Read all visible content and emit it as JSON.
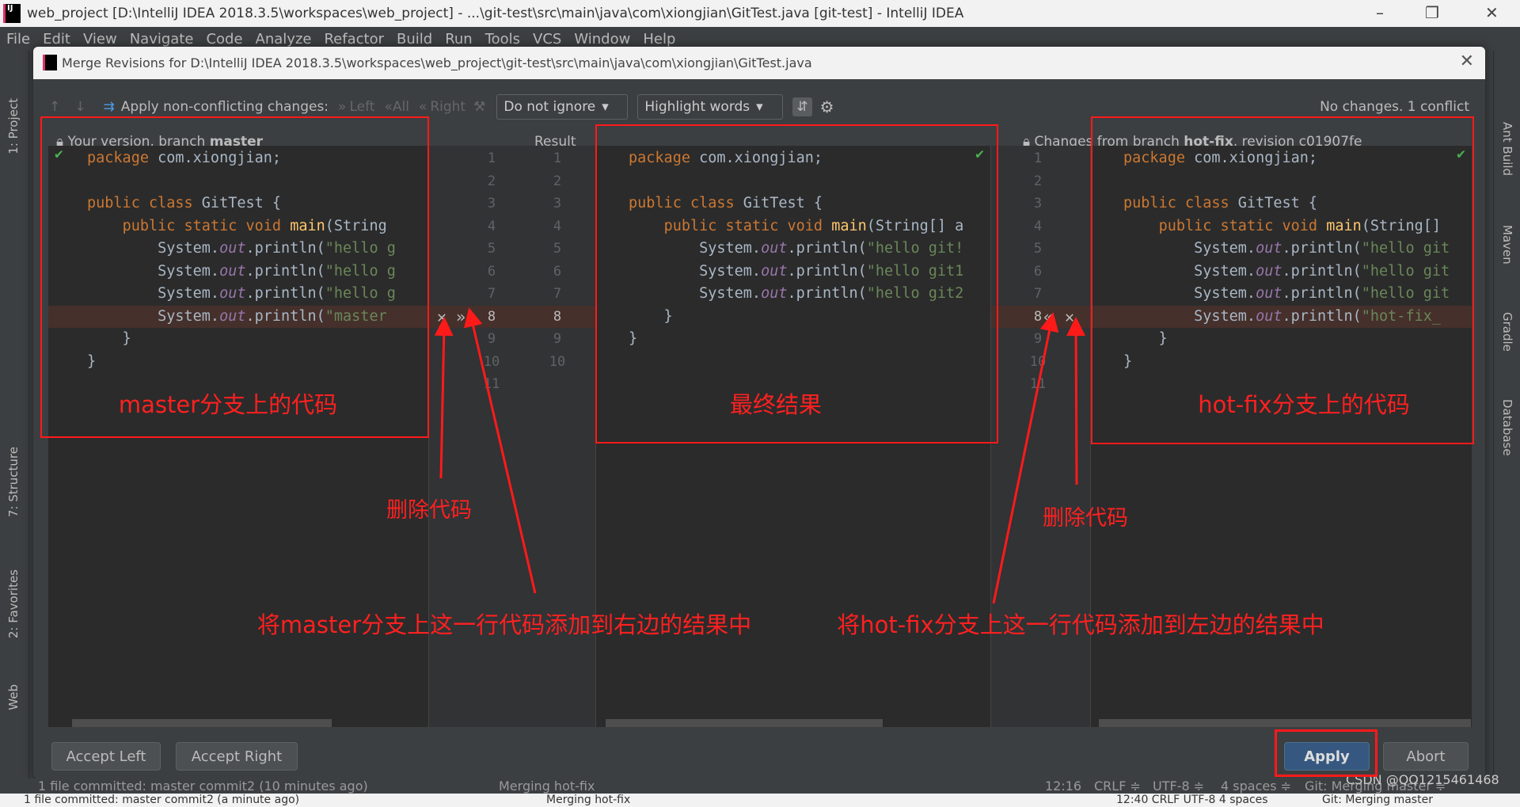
{
  "window": {
    "title": "web_project [D:\\IntelliJ IDEA 2018.3.5\\workspaces\\web_project] - ...\\git-test\\src\\main\\java\\com\\xiongjian\\GitTest.java [git-test] - IntelliJ IDEA",
    "minimize": "–",
    "maximize": "❐",
    "close": "✕"
  },
  "menu": [
    "File",
    "Edit",
    "View",
    "Navigate",
    "Code",
    "Analyze",
    "Refactor",
    "Build",
    "Run",
    "Tools",
    "VCS",
    "Window",
    "Help"
  ],
  "left_tools": [
    "1: Project",
    "7: Structure",
    "2: Favorites",
    "Web"
  ],
  "right_tools": [
    "Ant Build",
    "Maven",
    "Gradle",
    "Database"
  ],
  "dialog": {
    "title": "Merge Revisions for D:\\IntelliJ IDEA 2018.3.5\\workspaces\\web_project\\git-test\\src\\main\\java\\com\\xiongjian\\GitTest.java",
    "close": "✕",
    "toolbar": {
      "apply_label": "Apply non-conflicting changes:",
      "left": "Left",
      "all": "All",
      "right": "Right",
      "ignore": "Do not ignore",
      "highlight": "Highlight words",
      "status": "No changes. 1 conflict"
    },
    "left_header": {
      "prefix": "Your version, branch ",
      "branch": "master"
    },
    "result_header": "Result",
    "right_header": {
      "prefix": "Changes from branch ",
      "branch": "hot-fix",
      "suffix": ", revision c01907fe"
    },
    "left_code": [
      [
        [
          "kw",
          "package "
        ],
        [
          "pl",
          "com.xiongjian;"
        ]
      ],
      [],
      [
        [
          "kw",
          "public class "
        ],
        [
          "pl",
          "GitTest {"
        ]
      ],
      [
        [
          "pl",
          "    "
        ],
        [
          "kw",
          "public static void "
        ],
        [
          "fn",
          "main"
        ],
        [
          "pl",
          "(String"
        ]
      ],
      [
        [
          "pl",
          "        System."
        ],
        [
          "fld",
          "out"
        ],
        [
          "pl",
          ".println("
        ],
        [
          "str",
          "\"hello g"
        ]
      ],
      [
        [
          "pl",
          "        System."
        ],
        [
          "fld",
          "out"
        ],
        [
          "pl",
          ".println("
        ],
        [
          "str",
          "\"hello g"
        ]
      ],
      [
        [
          "pl",
          "        System."
        ],
        [
          "fld",
          "out"
        ],
        [
          "pl",
          ".println("
        ],
        [
          "str",
          "\"hello g"
        ]
      ],
      [
        [
          "pl",
          "        System."
        ],
        [
          "fld",
          "out"
        ],
        [
          "pl",
          ".println("
        ],
        [
          "str",
          "\"master"
        ]
      ],
      [
        [
          "pl",
          "    }"
        ]
      ],
      [
        [
          "pl",
          "}"
        ]
      ]
    ],
    "result_code": [
      [
        [
          "kw",
          "package "
        ],
        [
          "pl",
          "com.xiongjian;"
        ]
      ],
      [],
      [
        [
          "kw",
          "public class "
        ],
        [
          "pl",
          "GitTest {"
        ]
      ],
      [
        [
          "pl",
          "    "
        ],
        [
          "kw",
          "public static void "
        ],
        [
          "fn",
          "main"
        ],
        [
          "pl",
          "(String[] a"
        ]
      ],
      [
        [
          "pl",
          "        System."
        ],
        [
          "fld",
          "out"
        ],
        [
          "pl",
          ".println("
        ],
        [
          "str",
          "\"hello git!"
        ]
      ],
      [
        [
          "pl",
          "        System."
        ],
        [
          "fld",
          "out"
        ],
        [
          "pl",
          ".println("
        ],
        [
          "str",
          "\"hello git1"
        ]
      ],
      [
        [
          "pl",
          "        System."
        ],
        [
          "fld",
          "out"
        ],
        [
          "pl",
          ".println("
        ],
        [
          "str",
          "\"hello git2"
        ]
      ],
      [
        [
          "pl",
          "    }"
        ]
      ],
      [
        [
          "pl",
          "}"
        ]
      ]
    ],
    "right_code": [
      [
        [
          "kw",
          "package "
        ],
        [
          "pl",
          "com.xiongjian;"
        ]
      ],
      [],
      [
        [
          "kw",
          "public class "
        ],
        [
          "pl",
          "GitTest {"
        ]
      ],
      [
        [
          "pl",
          "    "
        ],
        [
          "kw",
          "public static void "
        ],
        [
          "fn",
          "main"
        ],
        [
          "pl",
          "(String[]"
        ]
      ],
      [
        [
          "pl",
          "        System."
        ],
        [
          "fld",
          "out"
        ],
        [
          "pl",
          ".println("
        ],
        [
          "str",
          "\"hello git"
        ]
      ],
      [
        [
          "pl",
          "        System."
        ],
        [
          "fld",
          "out"
        ],
        [
          "pl",
          ".println("
        ],
        [
          "str",
          "\"hello git"
        ]
      ],
      [
        [
          "pl",
          "        System."
        ],
        [
          "fld",
          "out"
        ],
        [
          "pl",
          ".println("
        ],
        [
          "str",
          "\"hello git"
        ]
      ],
      [
        [
          "pl",
          "        System."
        ],
        [
          "fld",
          "out"
        ],
        [
          "pl",
          ".println("
        ],
        [
          "str",
          "\"hot-fix_"
        ]
      ],
      [
        [
          "pl",
          "    }"
        ]
      ],
      [
        [
          "pl",
          "}"
        ]
      ]
    ],
    "left_line_numbers": [
      "1",
      "2",
      "3",
      "4",
      "5",
      "6",
      "7",
      "8",
      "9",
      "10",
      "11"
    ],
    "result_line_numbers": [
      "1",
      "2",
      "3",
      "4",
      "5",
      "6",
      "7",
      "8",
      "9",
      "10"
    ],
    "right_line_numbers": [
      "1",
      "2",
      "3",
      "4",
      "5",
      "6",
      "7",
      "8",
      "9",
      "10",
      "11"
    ],
    "buttons": {
      "accept_left": "Accept Left",
      "accept_right": "Accept Right",
      "apply": "Apply",
      "abort": "Abort"
    }
  },
  "status": {
    "message": "1 file committed: master commit2 (10 minutes ago)",
    "task": "Merging hot-fix",
    "position": "12:16",
    "line_sep": "CRLF ≑",
    "encoding": "UTF-8 ≑",
    "indent": "4 spaces ≑",
    "vcs": "Git: Merging master ≑"
  },
  "bottom": {
    "message": "1 file committed: master commit2 (a minute ago)",
    "task": "Merging hot-fix",
    "info": "12:40  CRLF  UTF-8  4 spaces",
    "vcs": "Git: Merging master"
  },
  "watermark": "CSDN @QQ1215461468",
  "annotations": {
    "left_box": "master分支上的代码",
    "result_box": "最终结果",
    "right_box": "hot-fix分支上的代码",
    "delete1": "删除代码",
    "delete2": "删除代码",
    "add_right": "将master分支上这一行代码添加到右边的结果中",
    "add_left": "将hot-fix分支上这一行代码添加到左边的结果中"
  },
  "colors": {
    "annotation": "#ff1a1a",
    "conflict": "#45302b",
    "apply": "#365880"
  }
}
